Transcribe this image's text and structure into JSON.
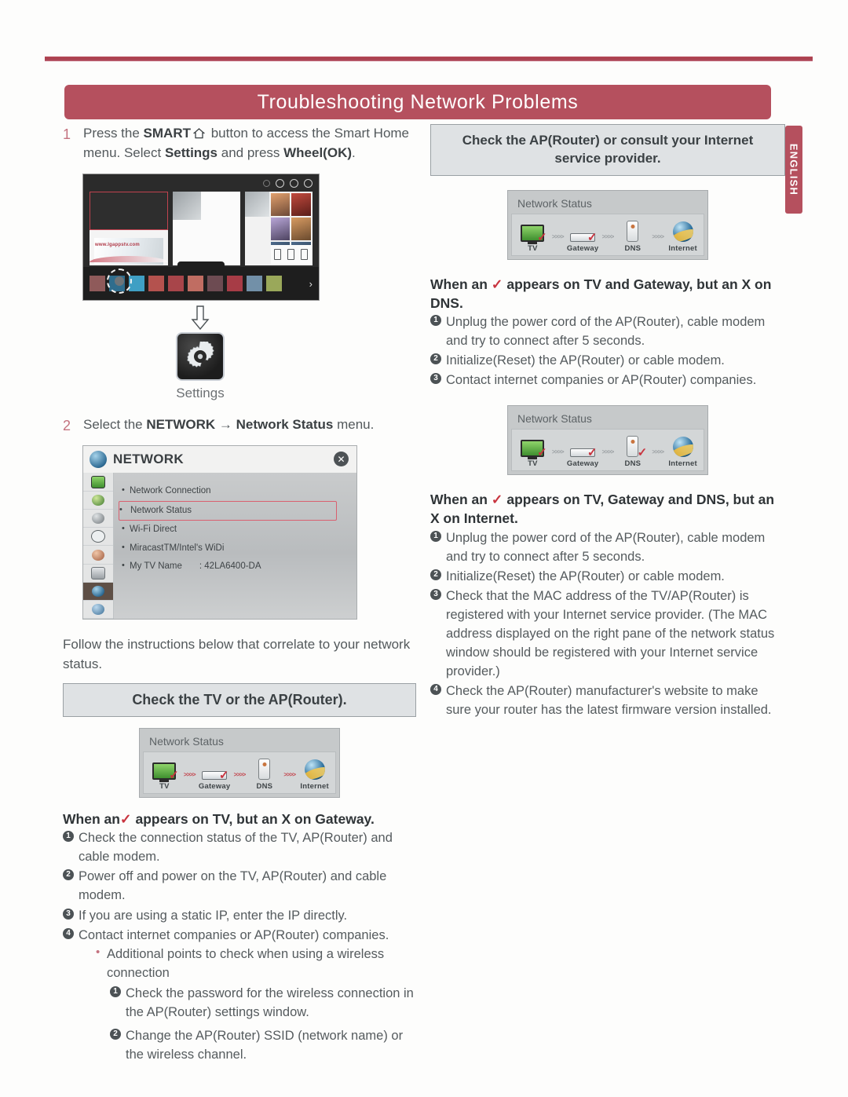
{
  "document": {
    "banner_title": "Troubleshooting Network Problems",
    "language_tab": "ENGLISH"
  },
  "left_column": {
    "step1": {
      "number": "1",
      "text_a": "Press the ",
      "bold_a": "SMART",
      "home_icon": "home-icon",
      "text_b": " button to access the Smart Home menu. Select ",
      "bold_b": "Settings",
      "text_c": " and press ",
      "bold_c": "Wheel(OK)",
      "text_d": "."
    },
    "smart_home_screenshot": {
      "name": "smart-home-screen",
      "dock_arrow": "›"
    },
    "arrow_down": "⇩",
    "settings_icon_label": "Settings",
    "step2": {
      "number": "2",
      "text_a": "Select the ",
      "bold_a": "NETWORK",
      "arrow": " → ",
      "bold_b": "Network Status",
      "text_b": " menu."
    },
    "network_menu": {
      "title": "NETWORK",
      "close_label": "✕",
      "items": [
        {
          "label": "Network Connection",
          "value": "",
          "highlighted": false
        },
        {
          "label": "Network Status",
          "value": "",
          "highlighted": true
        },
        {
          "label": "Wi-Fi Direct",
          "value": "",
          "highlighted": false
        },
        {
          "label": "MiracastTM/Intel's WiDi",
          "value": "",
          "highlighted": false
        },
        {
          "label": "My TV Name",
          "value": ": 42LA6400-DA",
          "highlighted": false
        }
      ],
      "rail_icons": [
        "picture-icon",
        "sound-icon",
        "channel-icon",
        "time-icon",
        "lock-icon",
        "option-icon",
        "network-icon",
        "support-icon"
      ]
    },
    "follow_text": "Follow the instructions below that correlate to your network status.",
    "grey_heading": "Check the TV or the AP(Router).",
    "network_status_widget": {
      "title": "Network Status",
      "nodes": [
        {
          "label": "TV",
          "icon": "tv-icon",
          "mark": "check"
        },
        {
          "label": "Gateway",
          "icon": "gateway-icon",
          "mark": "check"
        },
        {
          "label": "DNS",
          "icon": "dns-icon",
          "mark": "none"
        },
        {
          "label": "Internet",
          "icon": "internet-icon",
          "mark": "none"
        }
      ],
      "links": [
        "active",
        "active",
        "active"
      ]
    },
    "subhead_pre": "When an",
    "subhead_check": "✓",
    "subhead_post": "appears on TV, but an X on Gateway.",
    "items": [
      {
        "num": "❶",
        "text": "Check the connection status of the TV, AP(Router) and cable modem."
      },
      {
        "num": "❷",
        "text": "Power off and power on the TV, AP(Router) and cable modem."
      },
      {
        "num": "❸",
        "text": "If you are using a static IP, enter the IP directly."
      },
      {
        "num": "❹",
        "text": "Contact internet companies or AP(Router) companies."
      }
    ],
    "sub_note": "Additional points to check when using a wireless connection",
    "sub_items": [
      {
        "num": "❶",
        "text": "Check the password for the wireless connection in the AP(Router) settings window."
      },
      {
        "num": "❷",
        "text": "Change the AP(Router) SSID (network name) or the wireless channel."
      }
    ]
  },
  "right_column": {
    "grey_heading": "Check the AP(Router) or consult your Internet service provider.",
    "status_widget_1": {
      "title": "Network Status",
      "nodes": [
        {
          "label": "TV",
          "icon": "tv-icon",
          "mark": "check"
        },
        {
          "label": "Gateway",
          "icon": "gateway-icon",
          "mark": "check"
        },
        {
          "label": "DNS",
          "icon": "dns-icon",
          "mark": "none"
        },
        {
          "label": "Internet",
          "icon": "internet-icon",
          "mark": "none"
        }
      ]
    },
    "subhead_1_pre": "When an",
    "subhead_1_check": "✓",
    "subhead_1_post": "appears on TV and Gateway, but an X on DNS.",
    "items_1": [
      {
        "num": "❶",
        "text": "Unplug the power cord of the AP(Router), cable modem and try to connect after 5 seconds."
      },
      {
        "num": "❷",
        "text": "Initialize(Reset) the AP(Router) or cable modem."
      },
      {
        "num": "❸",
        "text": "Contact internet companies or AP(Router) companies."
      }
    ],
    "status_widget_2": {
      "title": "Network Status",
      "nodes": [
        {
          "label": "TV",
          "icon": "tv-icon",
          "mark": "check"
        },
        {
          "label": "Gateway",
          "icon": "gateway-icon",
          "mark": "check"
        },
        {
          "label": "DNS",
          "icon": "dns-icon",
          "mark": "check"
        },
        {
          "label": "Internet",
          "icon": "internet-icon",
          "mark": "none"
        }
      ]
    },
    "subhead_2_pre": "When an",
    "subhead_2_check": "✓",
    "subhead_2_post": "appears on TV, Gateway and DNS, but an X on Internet.",
    "items_2": [
      {
        "num": "❶",
        "text": "Unplug the power cord of the AP(Router), cable modem and try to connect after 5 seconds."
      },
      {
        "num": "❷",
        "text": "Initialize(Reset) the AP(Router) or cable modem."
      },
      {
        "num": "❸",
        "text": "Check that the MAC address of the TV/AP(Router) is registered with your Internet service provider. (The MAC address displayed on the right pane of the network status window should be registered with your Internet service provider.)"
      },
      {
        "num": "❹",
        "text": "Check the AP(Router) manufacturer's website to make sure your router has the latest firmware version installed."
      }
    ]
  },
  "colors": {
    "brand_red": "#b5505e",
    "accent_red": "#c8343f",
    "grey_bar": "#dfe2e4",
    "body_text": "#53595c"
  }
}
